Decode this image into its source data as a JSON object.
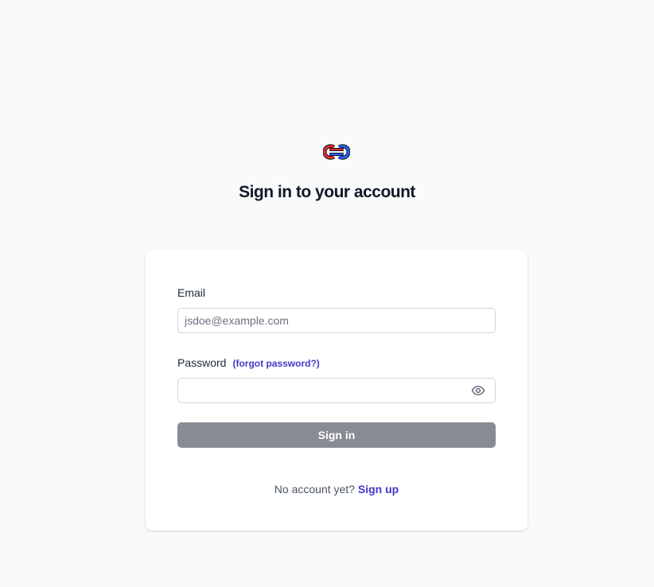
{
  "logo": {
    "icon": "knot-logo",
    "colors": {
      "red": "#e02a2a",
      "blue": "#2563eb"
    }
  },
  "page": {
    "title": "Sign in to your account"
  },
  "form": {
    "email_label": "Email",
    "email_placeholder": "jsdoe@example.com",
    "email_value": "",
    "password_label": "Password",
    "forgot_password": "(forgot password?)",
    "password_value": "",
    "toggle_icon": "eye-icon",
    "submit_label": "Sign in"
  },
  "footer": {
    "prompt": "No account yet?",
    "signup_label": "Sign up"
  },
  "colors": {
    "link": "#4338ca",
    "button": "#898b94",
    "background": "#f9fafb"
  }
}
